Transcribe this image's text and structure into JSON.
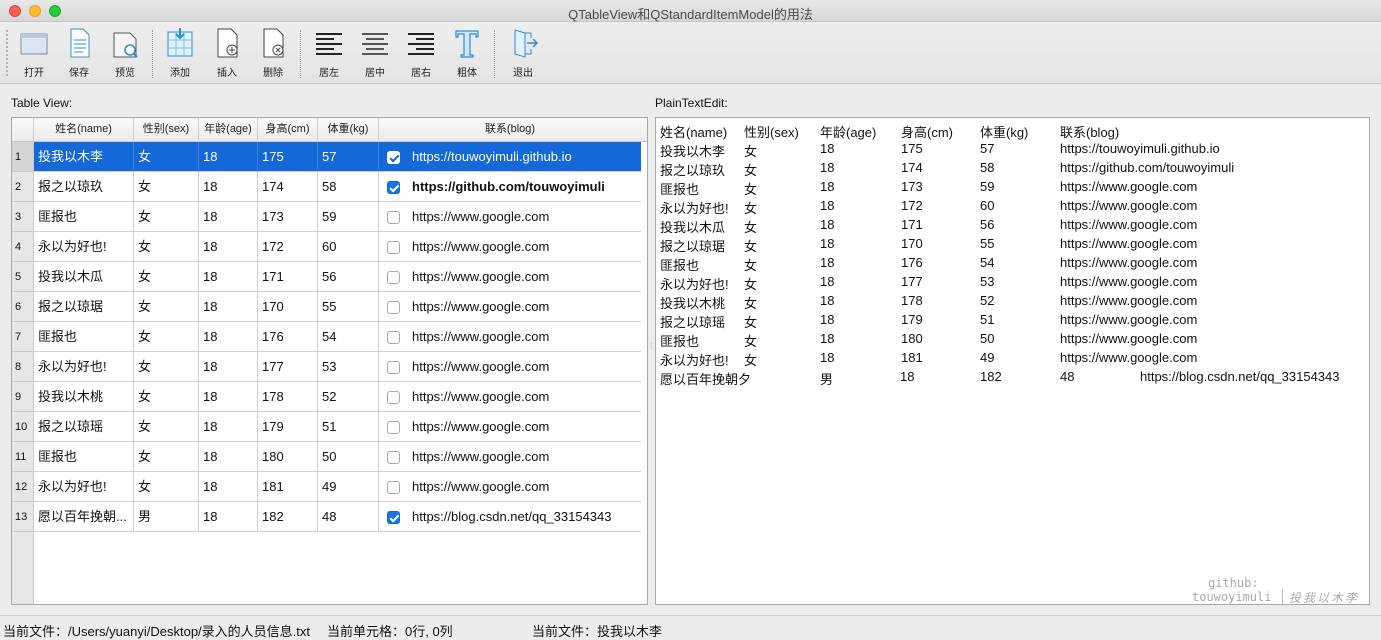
{
  "window": {
    "title": "QTableView和QStandardItemModel的用法"
  },
  "toolbar": {
    "open": {
      "label": "打开",
      "icon": "folder-icon"
    },
    "save": {
      "label": "保存",
      "icon": "document-icon"
    },
    "preview": {
      "label": "预览",
      "icon": "preview-icon"
    },
    "add": {
      "label": "添加",
      "icon": "add-row-icon"
    },
    "insert": {
      "label": "插入",
      "icon": "insert-icon"
    },
    "delete": {
      "label": "删除",
      "icon": "delete-icon"
    },
    "align_left": {
      "label": "居左",
      "icon": "align-left-icon"
    },
    "align_center": {
      "label": "居中",
      "icon": "align-center-icon"
    },
    "align_right": {
      "label": "居右",
      "icon": "align-right-icon"
    },
    "bold": {
      "label": "粗体",
      "icon": "bold-text-icon"
    },
    "exit": {
      "label": "退出",
      "icon": "exit-icon"
    }
  },
  "table_view": {
    "caption": "Table View:",
    "headers": [
      "姓名(name)",
      "性别(sex)",
      "年龄(age)",
      "身高(cm)",
      "体重(kg)",
      "联系(blog)"
    ],
    "rows": [
      {
        "num": "1",
        "name": "投我以木李",
        "sex": "女",
        "age": "18",
        "height": "175",
        "weight": "57",
        "checked": true,
        "blog": "https://touwoyimuli.github.io",
        "selected": true,
        "bold": false
      },
      {
        "num": "2",
        "name": "报之以琼玖",
        "sex": "女",
        "age": "18",
        "height": "174",
        "weight": "58",
        "checked": true,
        "blog": "https://github.com/touwoyimuli",
        "selected": false,
        "bold": true
      },
      {
        "num": "3",
        "name": "匪报也",
        "sex": "女",
        "age": "18",
        "height": "173",
        "weight": "59",
        "checked": false,
        "blog": "https://www.google.com",
        "selected": false,
        "bold": false
      },
      {
        "num": "4",
        "name": "永以为好也!",
        "sex": "女",
        "age": "18",
        "height": "172",
        "weight": "60",
        "checked": false,
        "blog": "https://www.google.com",
        "selected": false,
        "bold": false
      },
      {
        "num": "5",
        "name": "投我以木瓜",
        "sex": "女",
        "age": "18",
        "height": "171",
        "weight": "56",
        "checked": false,
        "blog": "https://www.google.com",
        "selected": false,
        "bold": false
      },
      {
        "num": "6",
        "name": "报之以琼琚",
        "sex": "女",
        "age": "18",
        "height": "170",
        "weight": "55",
        "checked": false,
        "blog": "https://www.google.com",
        "selected": false,
        "bold": false
      },
      {
        "num": "7",
        "name": "匪报也",
        "sex": "女",
        "age": "18",
        "height": "176",
        "weight": "54",
        "checked": false,
        "blog": "https://www.google.com",
        "selected": false,
        "bold": false
      },
      {
        "num": "8",
        "name": "永以为好也!",
        "sex": "女",
        "age": "18",
        "height": "177",
        "weight": "53",
        "checked": false,
        "blog": "https://www.google.com",
        "selected": false,
        "bold": false
      },
      {
        "num": "9",
        "name": "投我以木桃",
        "sex": "女",
        "age": "18",
        "height": "178",
        "weight": "52",
        "checked": false,
        "blog": "https://www.google.com",
        "selected": false,
        "bold": false
      },
      {
        "num": "10",
        "name": "报之以琼瑶",
        "sex": "女",
        "age": "18",
        "height": "179",
        "weight": "51",
        "checked": false,
        "blog": "https://www.google.com",
        "selected": false,
        "bold": false
      },
      {
        "num": "11",
        "name": "匪报也",
        "sex": "女",
        "age": "18",
        "height": "180",
        "weight": "50",
        "checked": false,
        "blog": "https://www.google.com",
        "selected": false,
        "bold": false
      },
      {
        "num": "12",
        "name": "永以为好也!",
        "sex": "女",
        "age": "18",
        "height": "181",
        "weight": "49",
        "checked": false,
        "blog": "https://www.google.com",
        "selected": false,
        "bold": false
      },
      {
        "num": "13",
        "name": "愿以百年挽朝...",
        "sex": "男",
        "age": "18",
        "height": "182",
        "weight": "48",
        "checked": true,
        "blog": "https://blog.csdn.net/qq_33154343",
        "selected": false,
        "bold": false
      }
    ]
  },
  "plain_text": {
    "caption": "PlainTextEdit:",
    "lines": [
      [
        "姓名(name)",
        "性别(sex)",
        "年龄(age)",
        "身高(cm)",
        "体重(kg)",
        "联系(blog)"
      ],
      [
        "投我以木李",
        "女",
        "18",
        "175",
        "57",
        "https://touwoyimuli.github.io"
      ],
      [
        "报之以琼玖",
        "女",
        "18",
        "174",
        "58",
        "https://github.com/touwoyimuli"
      ],
      [
        "匪报也",
        "女",
        "18",
        "173",
        "59",
        "https://www.google.com"
      ],
      [
        "永以为好也!",
        "女",
        "18",
        "172",
        "60",
        "https://www.google.com"
      ],
      [
        "投我以木瓜",
        "女",
        "18",
        "171",
        "56",
        "https://www.google.com"
      ],
      [
        "报之以琼琚",
        "女",
        "18",
        "170",
        "55",
        "https://www.google.com"
      ],
      [
        "匪报也",
        "女",
        "18",
        "176",
        "54",
        "https://www.google.com"
      ],
      [
        "永以为好也!",
        "女",
        "18",
        "177",
        "53",
        "https://www.google.com"
      ],
      [
        "投我以木桃",
        "女",
        "18",
        "178",
        "52",
        "https://www.google.com"
      ],
      [
        "报之以琼瑶",
        "女",
        "18",
        "179",
        "51",
        "https://www.google.com"
      ],
      [
        "匪报也",
        "女",
        "18",
        "180",
        "50",
        "https://www.google.com"
      ],
      [
        "永以为好也!",
        "女",
        "18",
        "181",
        "49",
        "https://www.google.com"
      ],
      [
        "愿以百年挽朝夕",
        "男",
        "18",
        "182",
        "48",
        "https://blog.csdn.net/qq_33154343"
      ]
    ]
  },
  "watermark": {
    "line1": "github:",
    "line2": "touwoyimuli",
    "signature": "投我以木李"
  },
  "statusbar": {
    "file": "当前文件：/Users/yuanyi/Desktop/录入的人员信息.txt",
    "cell": "当前单元格：0行, 0列",
    "current": "当前文件：投我以木李"
  },
  "colors": {
    "selection": "#1468d8",
    "checkbox": "#1a73e8",
    "toolbar_icon": "#2a8fd8"
  }
}
